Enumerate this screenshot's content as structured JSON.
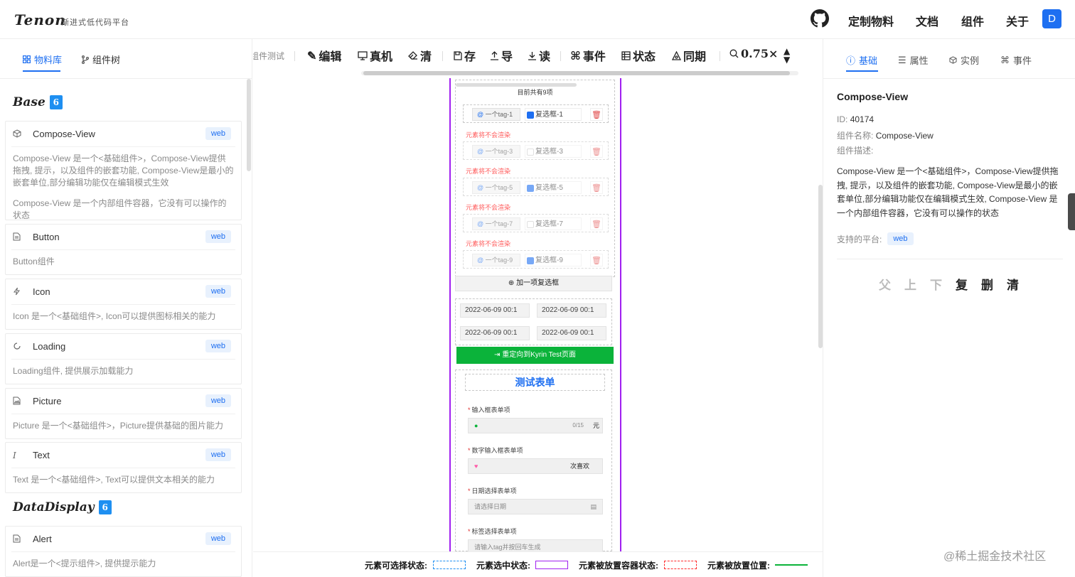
{
  "app": {
    "logo": "Tenon",
    "subtitle": "渐进式低代码平台",
    "avatar": "D"
  },
  "topnav": [
    "定制物料",
    "文档",
    "组件",
    "关于"
  ],
  "left": {
    "tabs": [
      "物料库",
      "组件树"
    ],
    "groups": [
      {
        "title": "Base",
        "count": "6"
      },
      {
        "title": "DataDisplay",
        "count": "6"
      }
    ],
    "cards": [
      {
        "name": "Compose-View",
        "tag": "web",
        "desc1": "Compose-View 是一个<基础组件>，Compose-View提供拖拽, 提示，以及组件的嵌套功能, Compose-View是最小的嵌套单位,部分编辑功能仅在编辑模式生效",
        "desc2": "Compose-View 是一个内部组件容器，它没有可以操作的状态"
      },
      {
        "name": "Button",
        "tag": "web",
        "desc1": "Button组件"
      },
      {
        "name": "Icon",
        "tag": "web",
        "desc1": "Icon 是一个<基础组件>, Icon可以提供图标相关的能力"
      },
      {
        "name": "Loading",
        "tag": "web",
        "desc1": "Loading组件, 提供展示加载能力"
      },
      {
        "name": "Picture",
        "tag": "web",
        "desc1": "Picture 是一个<基础组件>，Picture提供基础的图片能力"
      },
      {
        "name": "Text",
        "tag": "web",
        "desc1": "Text 是一个<基础组件>, Text可以提供文本相关的能力"
      },
      {
        "name": "Alert",
        "tag": "web",
        "desc1": "Alert是一个<提示组件>, 提供提示能力"
      }
    ]
  },
  "toolbar": {
    "page_name": "组件测试",
    "edit": "编辑",
    "device": "真机",
    "clear": "清",
    "save": "存",
    "export": "导",
    "import": "读",
    "event": "事件",
    "state": "状态",
    "sync": "同期",
    "zoom": "0.75×"
  },
  "canvas": {
    "count_text": "目前共有9项",
    "rows": [
      {
        "tag": "一个tag-1",
        "checkbox": "复选框-1",
        "checked": true,
        "warn": "元素将不会渲染"
      },
      {
        "tag": "一个tag-3",
        "checkbox": "复选框-3",
        "checked": false,
        "warn": "元素将不会渲染"
      },
      {
        "tag": "一个tag-5",
        "checkbox": "复选框-5",
        "checked": true,
        "warn": "元素将不会渲染"
      },
      {
        "tag": "一个tag-7",
        "checkbox": "复选框-7",
        "checked": false,
        "warn": "元素将不会渲染"
      },
      {
        "tag": "一个tag-9",
        "checkbox": "复选框-9",
        "checked": true,
        "warn": ""
      }
    ],
    "add_button": "加一项复选框",
    "dates": [
      "2022-06-09 00:1",
      "2022-06-09 00:1",
      "2022-06-09 00:1",
      "2022-06-09 00:1"
    ],
    "redirect_button": "重定向到Kyrin Test页面",
    "form_title": "测试表单",
    "fields": [
      {
        "label": "输入框表单项",
        "value": "",
        "counter": "0/15",
        "suffix": "元"
      },
      {
        "label": "数字输入框表单项",
        "value": "",
        "suffix": "次喜欢"
      },
      {
        "label": "日期选择表单项",
        "placeholder": "请选择日期"
      },
      {
        "label": "标签选择表单项",
        "placeholder": "请输入tag并按回车生成"
      }
    ]
  },
  "legend": [
    {
      "label": "元素可选择状态:",
      "color": "#1e8ff1"
    },
    {
      "label": "元素选中状态:",
      "color": "#a020f0"
    },
    {
      "label": "元素被放置容器状态:",
      "color": "#ff2a2a"
    },
    {
      "label": "元素被放置位置:",
      "color": "#0bb33a"
    }
  ],
  "right": {
    "tabs": [
      "基础",
      "属性",
      "实例",
      "事件"
    ],
    "title": "Compose-View",
    "id_label": "ID:",
    "id_value": "40174",
    "name_label": "组件名称:",
    "name_value": "Compose-View",
    "desc_label": "组件描述:",
    "desc": "Compose-View 是一个<基础组件>，Compose-View提供拖拽, 提示，以及组件的嵌套功能, Compose-View是最小的嵌套单位,部分编辑功能仅在编辑模式生效, Compose-View 是一个内部组件容器，它没有可以操作的状态",
    "platform_label": "支持的平台:",
    "platform": "web",
    "actions": [
      "父",
      "上",
      "下",
      "复",
      "删",
      "清"
    ]
  },
  "watermark": "@稀土掘金技术社区"
}
